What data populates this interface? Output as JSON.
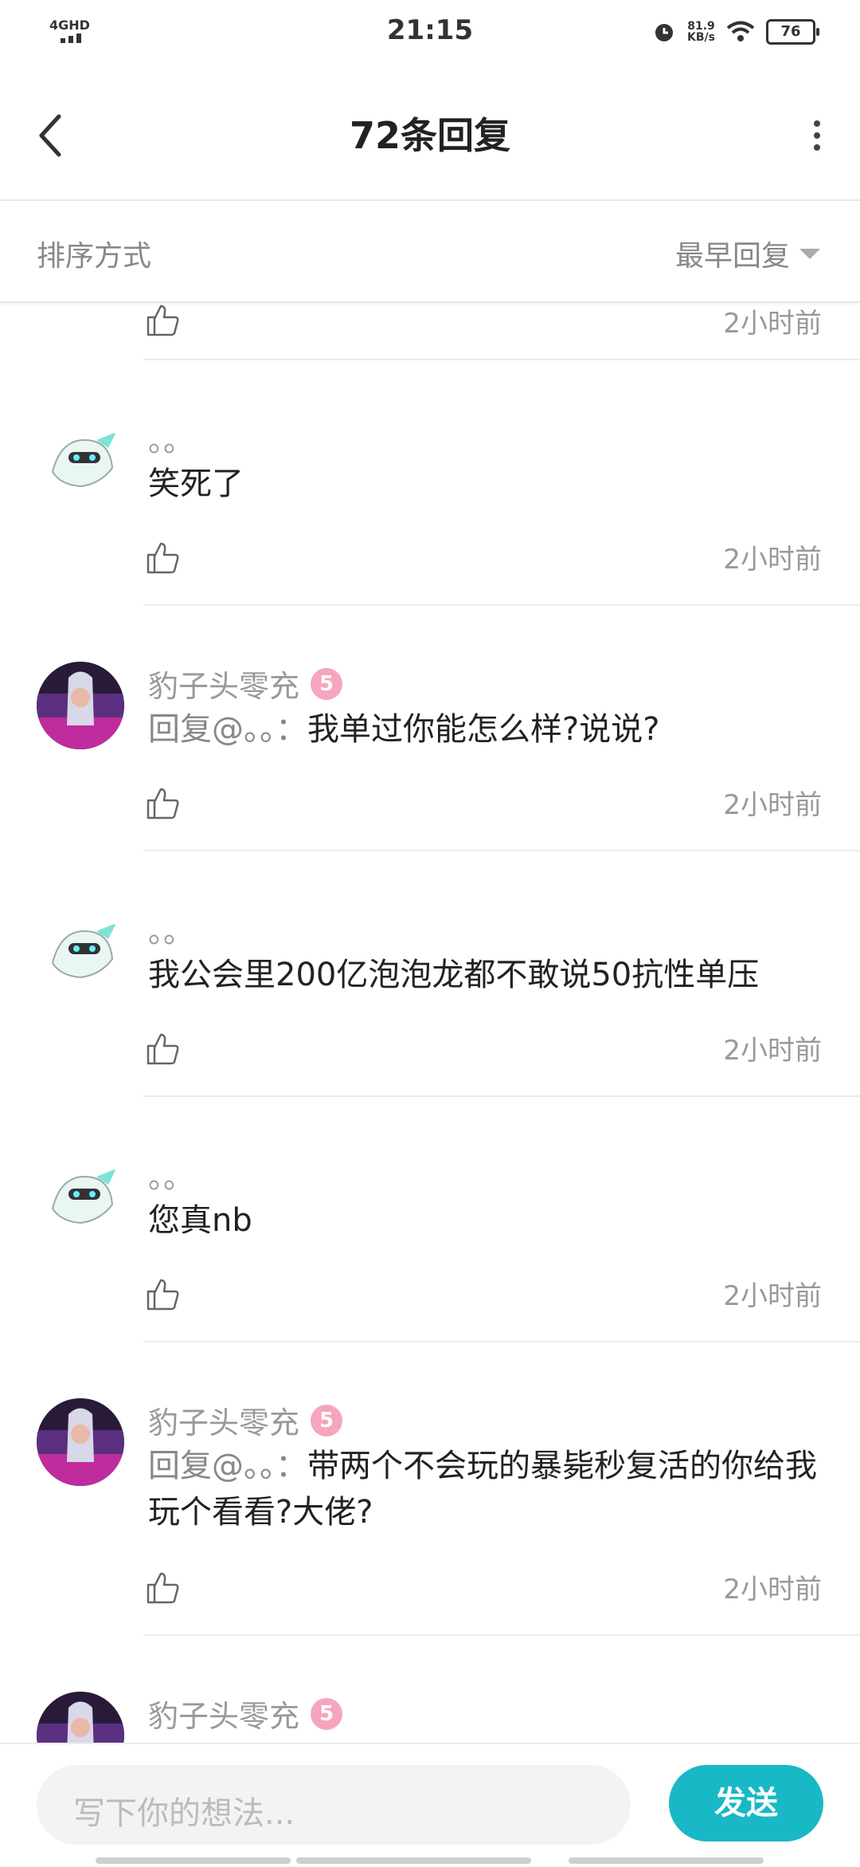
{
  "status_bar": {
    "network": "4GHD",
    "time": "21:15",
    "speed_value": "81.9",
    "speed_unit": "KB/s",
    "battery": "76"
  },
  "header": {
    "title": "72条回复"
  },
  "sort": {
    "label": "排序方式",
    "value": "最早回复"
  },
  "partial_top": {
    "time": "2小时前"
  },
  "comments": [
    {
      "user": "。。",
      "text": "笑死了",
      "time": "2小时前"
    },
    {
      "user": "豹子头零充",
      "level": "5",
      "mention": "回复@。。：",
      "text": "我单过你能怎么样?说说?",
      "time": "2小时前"
    },
    {
      "user": "。。",
      "text": "我公会里200亿泡泡龙都不敢说50抗性单压",
      "time": "2小时前"
    },
    {
      "user": "。。",
      "text": "您真nb",
      "time": "2小时前"
    },
    {
      "user": "豹子头零充",
      "level": "5",
      "mention": "回复@。。：",
      "text": "带两个不会玩的暴毙秒复活的你给我玩个看看?大佬?",
      "time": "2小时前"
    },
    {
      "user": "豹子头零充",
      "level": "5"
    }
  ],
  "composer": {
    "placeholder": "写下你的想法...",
    "send_label": "发送"
  },
  "colors": {
    "accent": "#19b8c6",
    "level_badge": "#f6a5bd"
  }
}
